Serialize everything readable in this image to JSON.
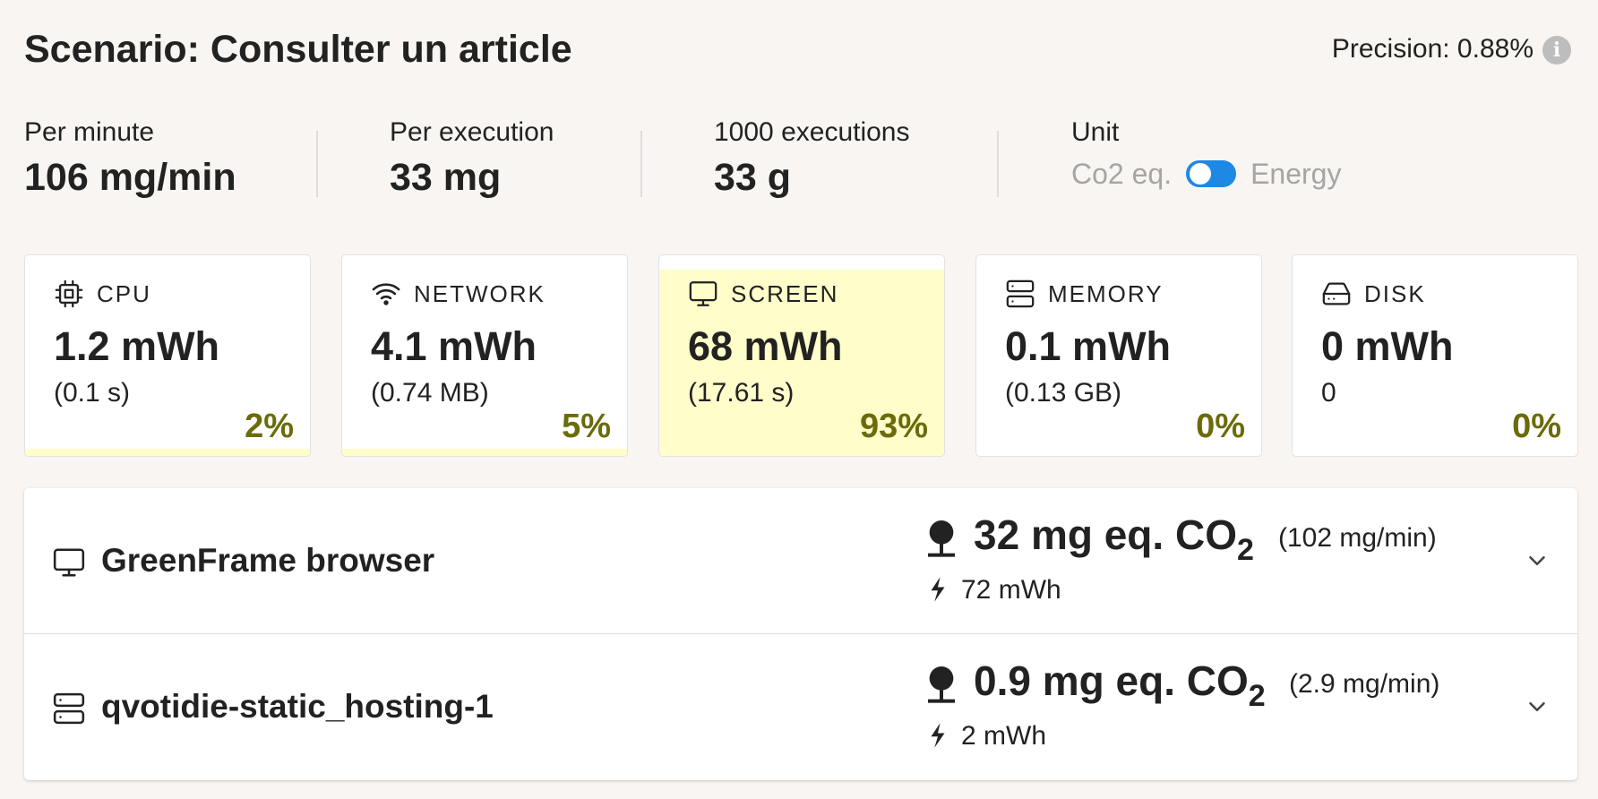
{
  "header": {
    "title": "Scenario: Consulter un article",
    "precision": "Precision: 0.88%",
    "info_glyph": "i"
  },
  "stats": {
    "per_minute": {
      "label": "Per minute",
      "value": "106 mg/min"
    },
    "per_execution": {
      "label": "Per execution",
      "value": "33 mg"
    },
    "thousand_exec": {
      "label": "1000 executions",
      "value": "33 g"
    },
    "unit": {
      "label": "Unit",
      "left": "Co2 eq.",
      "right": "Energy",
      "selected": "Co2 eq."
    }
  },
  "cards": [
    {
      "icon": "cpu-icon",
      "label": "CPU",
      "value": "1.2 mWh",
      "sub": "(0.1 s)",
      "percent": "2%",
      "share": 0.02
    },
    {
      "icon": "wifi-icon",
      "label": "NETWORK",
      "value": "4.1 mWh",
      "sub": "(0.74 MB)",
      "percent": "5%",
      "share": 0.05
    },
    {
      "icon": "monitor-icon",
      "label": "SCREEN",
      "value": "68 mWh",
      "sub": "(17.61 s)",
      "percent": "93%",
      "share": 0.93
    },
    {
      "icon": "server-icon",
      "label": "MEMORY",
      "value": "0.1 mWh",
      "sub": "(0.13 GB)",
      "percent": "0%",
      "share": 0
    },
    {
      "icon": "hard-drive-icon",
      "label": "DISK",
      "value": "0 mWh",
      "sub": "0",
      "percent": "0%",
      "share": 0
    }
  ],
  "containers": [
    {
      "icon": "monitor-icon",
      "name": "GreenFrame browser",
      "co2_value": "32 mg eq. CO",
      "co2_sub": "2",
      "rate": "(102 mg/min)",
      "energy": "72 mWh"
    },
    {
      "icon": "server-icon",
      "name": "qvotidie-static_hosting-1",
      "co2_value": "0.9 mg eq. CO",
      "co2_sub": "2",
      "rate": "(2.9 mg/min)",
      "energy": "2 mWh"
    }
  ],
  "colors": {
    "background": "#f8f5f3",
    "highlight": "#fffdca",
    "percent": "#6b6b0a",
    "toggle": "#1e88e5"
  }
}
